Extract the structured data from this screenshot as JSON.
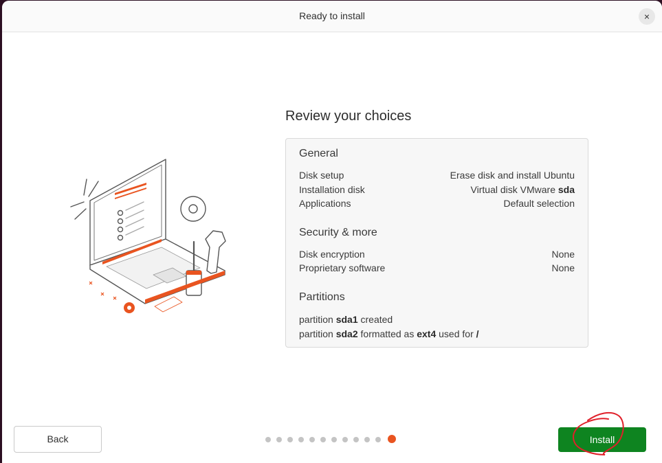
{
  "window": {
    "title": "Ready to install",
    "close_icon": "×"
  },
  "main": {
    "heading": "Review your choices"
  },
  "general": {
    "title": "General",
    "disk_setup_label": "Disk setup",
    "disk_setup_value": "Erase disk and install Ubuntu",
    "installation_disk_label": "Installation disk",
    "installation_disk_value_prefix": "Virtual disk VMware ",
    "installation_disk_value_bold": "sda",
    "applications_label": "Applications",
    "applications_value": "Default selection"
  },
  "security": {
    "title": "Security & more",
    "disk_encryption_label": "Disk encryption",
    "disk_encryption_value": "None",
    "proprietary_label": "Proprietary software",
    "proprietary_value": "None"
  },
  "partitions": {
    "title": "Partitions",
    "line1_prefix": "partition ",
    "line1_name": "sda1",
    "line1_suffix": " created",
    "line2_prefix": "partition ",
    "line2_name": "sda2",
    "line2_mid": " formatted as ",
    "line2_fs": "ext4",
    "line2_mid2": " used for ",
    "line2_mount": "/"
  },
  "footer": {
    "back_label": "Back",
    "install_label": "Install",
    "progress": {
      "total_steps": 12,
      "current_step": 12
    }
  },
  "colors": {
    "accent": "#e95420",
    "install_green": "#0e8420",
    "annotation_red": "#e0202a"
  },
  "icons": [
    "close-icon",
    "laptop-illustration",
    "gear-icon",
    "wrench-icon",
    "screwdriver-icon"
  ]
}
